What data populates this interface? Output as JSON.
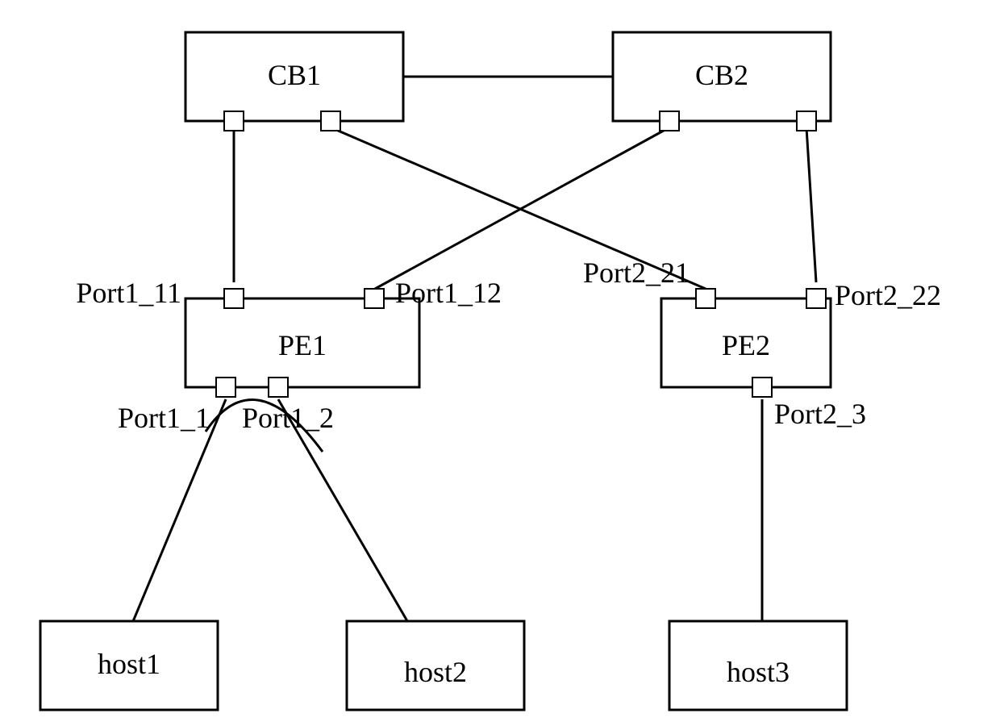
{
  "nodes": {
    "cb1": {
      "label": "CB1"
    },
    "cb2": {
      "label": "CB2"
    },
    "pe1": {
      "label": "PE1"
    },
    "pe2": {
      "label": "PE2"
    },
    "host1": {
      "label": "host1"
    },
    "host2": {
      "label": "host2"
    },
    "host3": {
      "label": "host3"
    }
  },
  "ports": {
    "p1_11": {
      "label": "Port1_11"
    },
    "p1_12": {
      "label": "Port1_12"
    },
    "p2_21": {
      "label": "Port2_21"
    },
    "p2_22": {
      "label": "Port2_22"
    },
    "p1_1": {
      "label": "Port1_1"
    },
    "p1_2": {
      "label": "Port1_2"
    },
    "p2_3": {
      "label": "Port2_3"
    }
  },
  "chart_data": {
    "type": "diagram",
    "title": "",
    "nodes": [
      {
        "id": "CB1",
        "kind": "CB"
      },
      {
        "id": "CB2",
        "kind": "CB"
      },
      {
        "id": "PE1",
        "kind": "PE",
        "ports_up": [
          "Port1_11",
          "Port1_12"
        ],
        "ports_down": [
          "Port1_1",
          "Port1_2"
        ]
      },
      {
        "id": "PE2",
        "kind": "PE",
        "ports_up": [
          "Port2_21",
          "Port2_22"
        ],
        "ports_down": [
          "Port2_3"
        ]
      },
      {
        "id": "host1",
        "kind": "host"
      },
      {
        "id": "host2",
        "kind": "host"
      },
      {
        "id": "host3",
        "kind": "host"
      }
    ],
    "edges": [
      {
        "from": "CB1",
        "to": "CB2"
      },
      {
        "from": "CB1",
        "to": "PE1",
        "to_port": "Port1_11"
      },
      {
        "from": "CB1",
        "to": "PE2",
        "to_port": "Port2_21"
      },
      {
        "from": "CB2",
        "to": "PE1",
        "to_port": "Port1_12"
      },
      {
        "from": "CB2",
        "to": "PE2",
        "to_port": "Port2_22"
      },
      {
        "from": "PE1",
        "from_port": "Port1_1",
        "to": "host1"
      },
      {
        "from": "PE1",
        "from_port": "Port1_2",
        "to": "host2"
      },
      {
        "from": "PE2",
        "from_port": "Port2_3",
        "to": "host3"
      }
    ],
    "annotations": [
      {
        "type": "arc",
        "between": [
          "Port1_1",
          "Port1_2"
        ]
      }
    ]
  }
}
